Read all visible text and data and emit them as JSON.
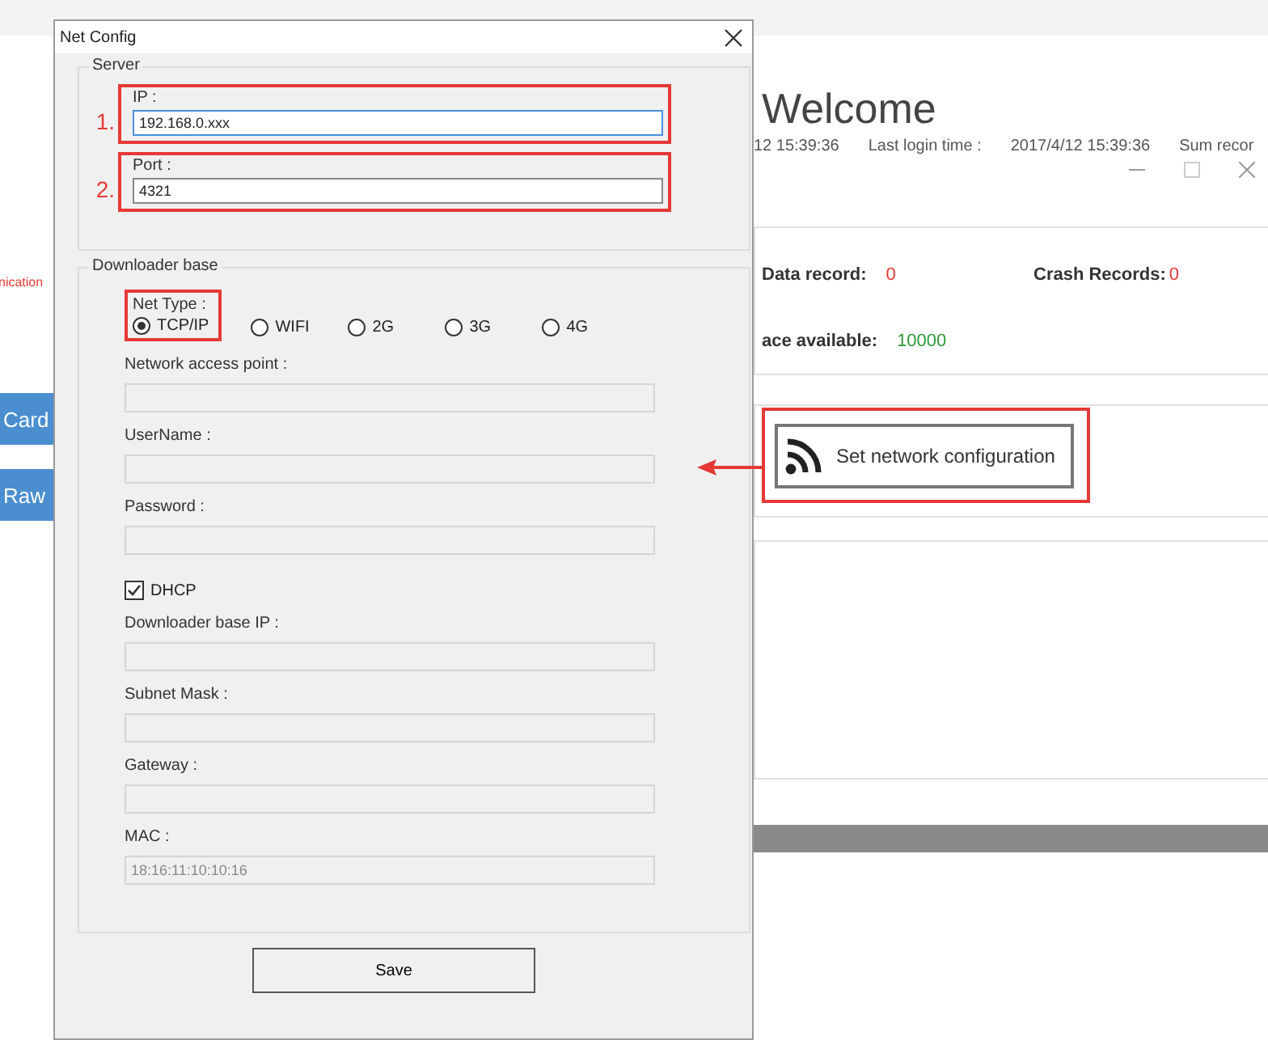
{
  "background_app": {
    "left_panel": {
      "notice": "nication",
      "buttons": [
        "Card",
        "Raw"
      ]
    },
    "heading": "Welcome",
    "info_line": [
      {
        "text": "12 15:39:36"
      },
      {
        "text": "Last login time :"
      },
      {
        "text": "2017/4/12 15:39:36"
      },
      {
        "text": "Sum recor"
      }
    ],
    "stats": [
      {
        "label": "Data record:",
        "value": "0",
        "color": "#e53935"
      },
      {
        "label": "Crash Records:",
        "value": "0",
        "color": "#e53935"
      },
      {
        "label": "ace available:",
        "value": "10000",
        "color": "#2e9a3a"
      }
    ],
    "action_button": "Set network configuration"
  },
  "dialog": {
    "title": "Net Config",
    "server": {
      "legend": "Server",
      "fields": [
        {
          "marker": "1.",
          "label": "IP :",
          "value": "192.168.0.xxx",
          "focused": true
        },
        {
          "marker": "2.",
          "label": "Port :",
          "value": "4321",
          "focused": false
        }
      ]
    },
    "downloader": {
      "legend": "Downloader base",
      "net_type_label": "Net Type :",
      "net_types": [
        {
          "label": "TCP/IP",
          "selected": true
        },
        {
          "label": "WIFI",
          "selected": false
        },
        {
          "label": "2G",
          "selected": false
        },
        {
          "label": "3G",
          "selected": false
        },
        {
          "label": "4G",
          "selected": false
        }
      ],
      "items": [
        {
          "kind": "field",
          "label": "Network access point :",
          "disabled": true
        },
        {
          "kind": "field",
          "label": "UserName :",
          "disabled": true
        },
        {
          "kind": "field",
          "label": "Password :",
          "disabled": true
        },
        {
          "kind": "checkbox",
          "label": "DHCP",
          "checked": true
        },
        {
          "kind": "field",
          "label": "Downloader base IP :",
          "disabled": true
        },
        {
          "kind": "field",
          "label": "Subnet Mask :",
          "disabled": true
        },
        {
          "kind": "field",
          "label": "Gateway :",
          "disabled": true
        },
        {
          "kind": "field",
          "label": "MAC :",
          "value": "18:16:11:10:10:16",
          "disabled": true
        }
      ]
    },
    "save_button": "Save"
  }
}
